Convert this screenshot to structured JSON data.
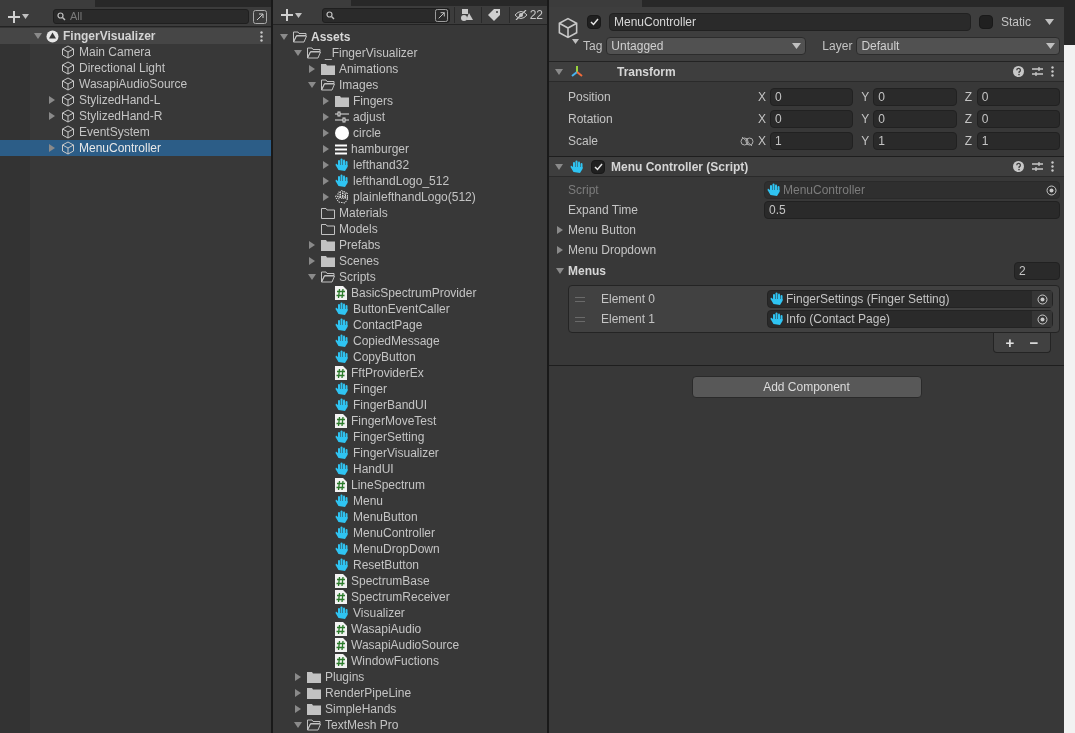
{
  "hierarchy": {
    "search": {
      "placeholder": "All"
    },
    "scene": {
      "name": "FingerVisualizer",
      "expanded": true,
      "children": [
        {
          "name": "Main Camera",
          "selected": false
        },
        {
          "name": "Directional Light",
          "selected": false
        },
        {
          "name": "WasapiAudioSource",
          "selected": false
        },
        {
          "name": "StylizedHand-L",
          "expanded": false,
          "selected": false
        },
        {
          "name": "StylizedHand-R",
          "expanded": false,
          "selected": false
        },
        {
          "name": "EventSystem",
          "selected": false
        },
        {
          "name": "MenuController",
          "expanded": false,
          "selected": true
        }
      ]
    }
  },
  "project": {
    "hidden_count": "22",
    "tree": [
      {
        "name": "Assets",
        "kind": "folder-open",
        "expanded": true,
        "bold": true,
        "children": [
          {
            "name": "_FingerVisualizer",
            "kind": "folder-open",
            "expanded": true,
            "children": [
              {
                "name": "Animations",
                "kind": "folder",
                "expanded": false
              },
              {
                "name": "Images",
                "kind": "folder-open",
                "expanded": true,
                "children": [
                  {
                    "name": "Fingers",
                    "kind": "folder",
                    "expanded": false
                  },
                  {
                    "name": "adjust",
                    "kind": "adjust",
                    "expanded": false
                  },
                  {
                    "name": "circle",
                    "kind": "circle",
                    "expanded": false
                  },
                  {
                    "name": "hamburger",
                    "kind": "hamburger",
                    "expanded": false
                  },
                  {
                    "name": "lefthand32",
                    "kind": "hand",
                    "expanded": false
                  },
                  {
                    "name": "lefthandLogo_512",
                    "kind": "hand",
                    "expanded": false
                  },
                  {
                    "name": "plainlefthandLogo(512)",
                    "kind": "hand-outline",
                    "expanded": false
                  }
                ]
              },
              {
                "name": "Materials",
                "kind": "folder-empty"
              },
              {
                "name": "Models",
                "kind": "folder-empty"
              },
              {
                "name": "Prefabs",
                "kind": "folder",
                "expanded": false
              },
              {
                "name": "Scenes",
                "kind": "folder",
                "expanded": false
              },
              {
                "name": "Scripts",
                "kind": "folder-open",
                "expanded": true,
                "children": [
                  {
                    "name": "BasicSpectrumProvider",
                    "kind": "script"
                  },
                  {
                    "name": "ButtonEventCaller",
                    "kind": "hand"
                  },
                  {
                    "name": "ContactPage",
                    "kind": "hand"
                  },
                  {
                    "name": "CopiedMessage",
                    "kind": "hand"
                  },
                  {
                    "name": "CopyButton",
                    "kind": "hand"
                  },
                  {
                    "name": "FftProviderEx",
                    "kind": "script"
                  },
                  {
                    "name": "Finger",
                    "kind": "hand"
                  },
                  {
                    "name": "FingerBandUI",
                    "kind": "hand"
                  },
                  {
                    "name": "FingerMoveTest",
                    "kind": "script"
                  },
                  {
                    "name": "FingerSetting",
                    "kind": "hand"
                  },
                  {
                    "name": "FingerVisualizer",
                    "kind": "hand"
                  },
                  {
                    "name": "HandUI",
                    "kind": "hand"
                  },
                  {
                    "name": "LineSpectrum",
                    "kind": "script"
                  },
                  {
                    "name": "Menu",
                    "kind": "hand"
                  },
                  {
                    "name": "MenuButton",
                    "kind": "hand"
                  },
                  {
                    "name": "MenuController",
                    "kind": "hand"
                  },
                  {
                    "name": "MenuDropDown",
                    "kind": "hand"
                  },
                  {
                    "name": "ResetButton",
                    "kind": "hand"
                  },
                  {
                    "name": "SpectrumBase",
                    "kind": "script"
                  },
                  {
                    "name": "SpectrumReceiver",
                    "kind": "script"
                  },
                  {
                    "name": "Visualizer",
                    "kind": "hand"
                  },
                  {
                    "name": "WasapiAudio",
                    "kind": "script"
                  },
                  {
                    "name": "WasapiAudioSource",
                    "kind": "script"
                  },
                  {
                    "name": "WindowFuctions",
                    "kind": "script"
                  }
                ]
              }
            ]
          },
          {
            "name": "Plugins",
            "kind": "folder",
            "expanded": false
          },
          {
            "name": "RenderPipeLine",
            "kind": "folder",
            "expanded": false
          },
          {
            "name": "SimpleHands",
            "kind": "folder",
            "expanded": false
          },
          {
            "name": "TextMesh Pro",
            "kind": "folder-open",
            "expanded": true
          }
        ]
      }
    ]
  },
  "inspector": {
    "object": {
      "name": "MenuController",
      "active": true,
      "static": false,
      "static_label": "Static",
      "tag_label": "Tag",
      "tag": "Untagged",
      "layer_label": "Layer",
      "layer": "Default"
    },
    "components": [
      {
        "kind": "transform",
        "title": "Transform",
        "expanded": true,
        "rows": [
          {
            "label": "Position",
            "linked": false,
            "axes": [
              {
                "axis": "X",
                "value": "0"
              },
              {
                "axis": "Y",
                "value": "0"
              },
              {
                "axis": "Z",
                "value": "0"
              }
            ]
          },
          {
            "label": "Rotation",
            "linked": false,
            "axes": [
              {
                "axis": "X",
                "value": "0"
              },
              {
                "axis": "Y",
                "value": "0"
              },
              {
                "axis": "Z",
                "value": "0"
              }
            ]
          },
          {
            "label": "Scale",
            "linked": true,
            "axes": [
              {
                "axis": "X",
                "value": "1"
              },
              {
                "axis": "Y",
                "value": "1"
              },
              {
                "axis": "Z",
                "value": "1"
              }
            ]
          }
        ]
      },
      {
        "kind": "script",
        "title": "Menu Controller (Script)",
        "expanded": true,
        "enabled": true,
        "fields": [
          {
            "kind": "object",
            "label": "Script",
            "value": "MenuController",
            "disabled": true
          },
          {
            "kind": "text",
            "label": "Expand Time",
            "value": "0.5"
          },
          {
            "kind": "foldout",
            "label": "Menu Button",
            "expanded": false
          },
          {
            "kind": "foldout",
            "label": "Menu Dropdown",
            "expanded": false
          },
          {
            "kind": "list",
            "label": "Menus",
            "expanded": true,
            "count": "2",
            "elements": [
              {
                "label": "Element 0",
                "value": "FingerSettings (Finger Setting)"
              },
              {
                "label": "Element 1",
                "value": "Info (Contact Page)"
              }
            ],
            "buttons": [
              "+",
              "−"
            ]
          }
        ]
      }
    ],
    "add_component": "Add Component"
  }
}
